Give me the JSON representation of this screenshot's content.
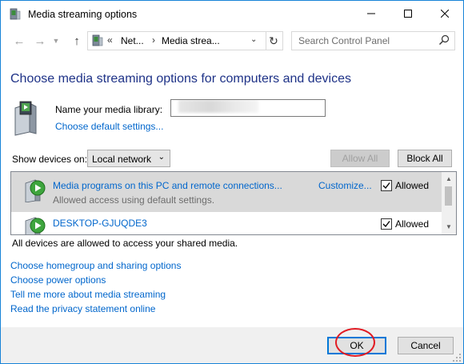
{
  "window": {
    "title": "Media streaming options"
  },
  "address": {
    "overflow": "«",
    "segments": [
      "Net...",
      "Media strea..."
    ],
    "separator": "›"
  },
  "search": {
    "placeholder": "Search Control Panel"
  },
  "page": {
    "title": "Choose media streaming options for computers and devices"
  },
  "library": {
    "label": "Name your media library:",
    "value": "",
    "defaults_link": "Choose default settings..."
  },
  "devices_filter": {
    "label": "Show devices on:",
    "selected": "Local network",
    "allow_all": "Allow All",
    "block_all": "Block All"
  },
  "devices": [
    {
      "name": "Media programs on this PC and remote connections...",
      "description": "Allowed access using default settings.",
      "customize": "Customize...",
      "status": "Allowed",
      "checked": true
    },
    {
      "name": "DESKTOP-GJUQDE3",
      "status": "Allowed",
      "checked": true
    }
  ],
  "summary": "All devices are allowed to access your shared media.",
  "links": [
    "Choose homegroup and sharing options",
    "Choose power options",
    "Tell me more about media streaming",
    "Read the privacy statement online"
  ],
  "footer": {
    "ok": "OK",
    "cancel": "Cancel"
  },
  "colors": {
    "accent": "#0078d7",
    "link": "#0066cc",
    "heading": "#1e3287",
    "annotation": "#e21b23",
    "selected_row": "#d9d9d9"
  },
  "icons": [
    "media-streaming-icon",
    "minimize-icon",
    "maximize-icon",
    "close-icon",
    "back-arrow-icon",
    "forward-arrow-icon",
    "up-arrow-icon",
    "refresh-icon",
    "search-icon",
    "media-library-icon",
    "media-device-icon",
    "checkmark-icon"
  ]
}
